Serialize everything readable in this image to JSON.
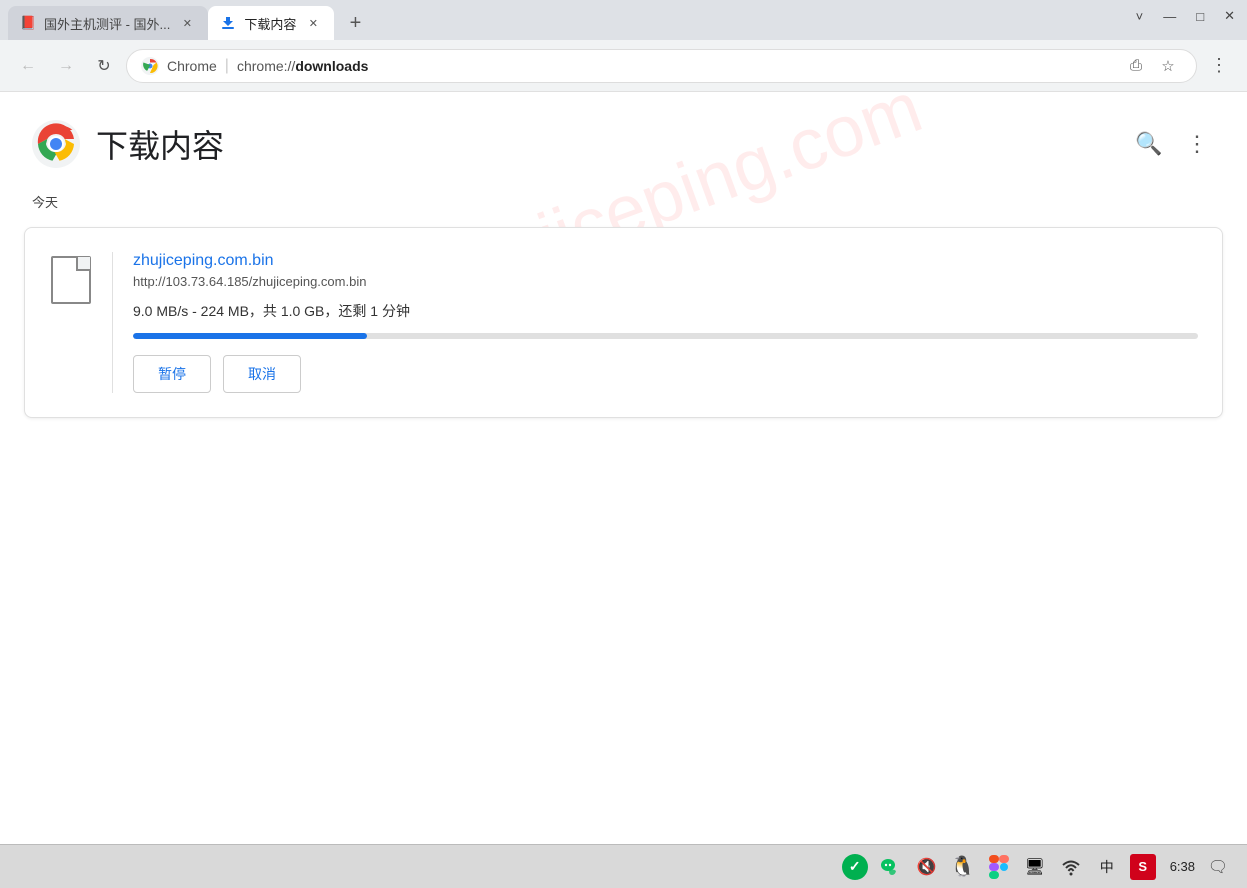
{
  "titlebar": {
    "controls": {
      "chevron": "˅",
      "minimize": "—",
      "maximize": "□",
      "close": "✕"
    }
  },
  "tabs": [
    {
      "id": "tab1",
      "label": "国外主机测评 - 国外...",
      "favicon": "red-bookmark",
      "active": false
    },
    {
      "id": "tab2",
      "label": "下载内容",
      "favicon": "download",
      "active": true
    }
  ],
  "new_tab_label": "+",
  "toolbar": {
    "back_label": "←",
    "forward_label": "→",
    "reload_label": "↻",
    "chrome_label": "Chrome",
    "url_prefix": "chrome://",
    "url_domain": "downloads",
    "share_label": "⎙",
    "star_label": "☆",
    "menu_label": "⋮"
  },
  "page": {
    "title": "下载内容",
    "section_today": "今天",
    "search_label": "🔍",
    "menu_label": "⋮",
    "watermark": "zhujiceping.com"
  },
  "download": {
    "filename": "zhujiceping.com.bin",
    "url": "http://103.73.64.185/zhujiceping.com.bin",
    "status": "9.0 MB/s - 224 MB，共 1.0 GB，还剩 1 分钟",
    "progress_percent": 22,
    "pause_label": "暂停",
    "cancel_label": "取消"
  },
  "taskbar": {
    "check_icon": "✓",
    "wechat_icon": "💬",
    "volume_icon": "🔇",
    "qq_icon": "🐧",
    "figma_icon": "🅵",
    "screen_icon": "🖥",
    "wifi_icon": "📶",
    "chinese_icon": "中",
    "sougou_icon": "S",
    "time": "6:38",
    "notification_icon": "🗨"
  }
}
